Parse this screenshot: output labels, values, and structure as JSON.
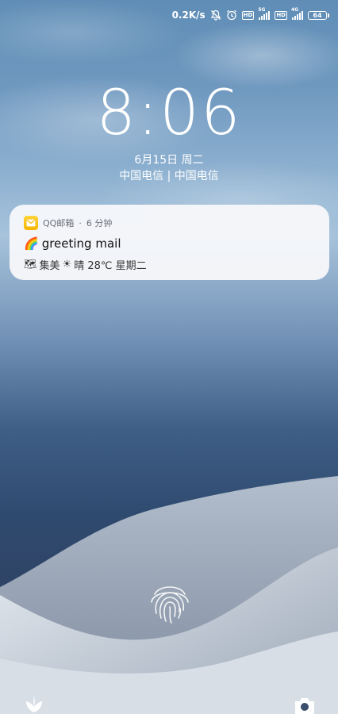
{
  "status_bar": {
    "net_speed": "0.2K/s",
    "sim1_gen": "5G",
    "sim2_gen": "4G",
    "battery": "64",
    "icons": [
      "mute-bell-icon",
      "alarm-icon",
      "hd-icon",
      "signal-icon",
      "hd-icon",
      "signal-icon",
      "battery-icon"
    ]
  },
  "lockscreen": {
    "time": "8:06",
    "date": "6月15日 周二",
    "carrier": "中国电信 | 中国电信"
  },
  "notification": {
    "app_name": "QQ邮箱",
    "separator": "·",
    "time_ago": "6 分钟",
    "title_emoji": "🌈",
    "title": "greeting mail",
    "body_emoji_1": "🗺",
    "body_place": "集美",
    "body_emoji_2": "☀",
    "body_weather": "晴 28℃ 星期二",
    "app_icon": "mail-envelope-icon",
    "icon_color": "#f7b500"
  },
  "bottom": {
    "left_icon": "flower-icon",
    "right_icon": "camera-icon"
  }
}
